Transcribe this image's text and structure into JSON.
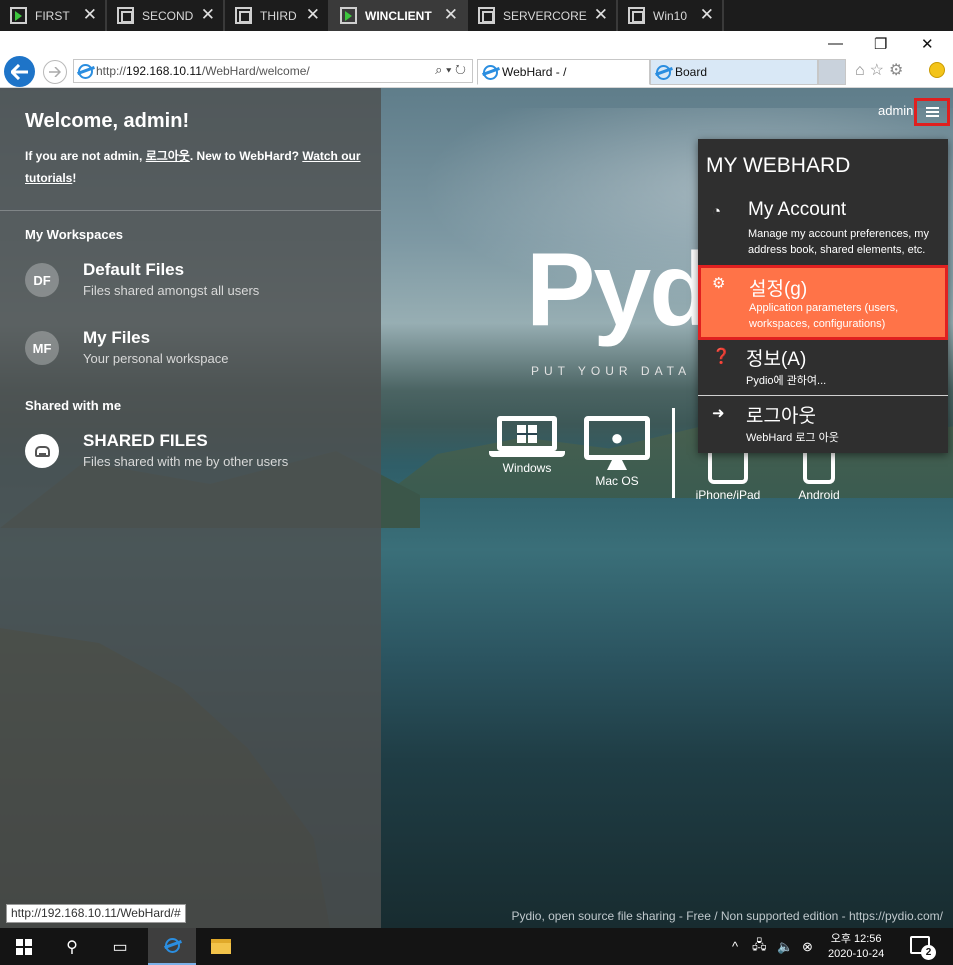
{
  "vm_tabs": [
    {
      "label": "FIRST",
      "active": false,
      "icon": "vm-play-icon"
    },
    {
      "label": "SECOND",
      "active": false,
      "icon": "vm-window-icon"
    },
    {
      "label": "THIRD",
      "active": false,
      "icon": "vm-window-icon"
    },
    {
      "label": "WINCLIENT",
      "active": true,
      "icon": "vm-play-icon"
    },
    {
      "label": "SERVERCORE",
      "active": false,
      "icon": "vm-window-icon"
    },
    {
      "label": "Win10",
      "active": false,
      "icon": "vm-window-icon"
    }
  ],
  "browser": {
    "url_prefix": "http://",
    "url_host": "192.168.10.11",
    "url_path": "/WebHard/welcome/",
    "tabs": [
      {
        "label": "WebHard - /",
        "active": true
      },
      {
        "label": "Board",
        "active": false
      }
    ]
  },
  "left_panel": {
    "welcome": "Welcome, admin!",
    "sub_prefix": "If you are not admin, ",
    "logout_link": "로그아웃",
    "sub_middle": ". New to WebHard? ",
    "tutorial_link": "Watch our tutorials",
    "sub_suffix": "!",
    "workspaces_heading": "My Workspaces",
    "workspaces": [
      {
        "initials": "DF",
        "title": "Default Files",
        "desc": "Files shared amongst all users"
      },
      {
        "initials": "MF",
        "title": "My Files",
        "desc": "Your personal workspace"
      }
    ],
    "shared_heading": "Shared with me",
    "shared": {
      "title": "SHARED FILES",
      "desc": "Files shared with me by other users",
      "icon": "drive-icon"
    }
  },
  "center": {
    "logo": "Pydio",
    "tagline": "PUT YOUR DATA",
    "apps": [
      {
        "label": "Windows",
        "icon": "windows-laptop-icon"
      },
      {
        "label": "Mac OS",
        "icon": "apple-monitor-icon"
      },
      {
        "label": "iPhone/iPad",
        "icon": "phone-icon"
      },
      {
        "label": "Android",
        "icon": "android-phone-icon"
      }
    ]
  },
  "user_menu": {
    "username": "admin",
    "title": "MY WEBHARD",
    "items": [
      {
        "label": "My Account",
        "desc": "Manage my account preferences, my address book, shared elements, etc.",
        "icon": "dashboard-icon",
        "highlighted": false
      },
      {
        "label": "설정(g)",
        "desc": "Application parameters (users, workspaces, configurations)",
        "icon": "gears-icon",
        "highlighted": true
      },
      {
        "label": "정보(A)",
        "desc": "Pydio에 관하여...",
        "icon": "question-circle-icon",
        "highlighted": false
      },
      {
        "label": "로그아웃",
        "desc": "WebHard 로그 아웃",
        "icon": "sign-out-icon",
        "highlighted": false
      }
    ]
  },
  "footer": "Pydio, open source file sharing - Free / Non supported edition - https://pydio.com/",
  "status_url": "http://192.168.10.11/WebHard/#",
  "taskbar": {
    "clock_time": "오후 12:56",
    "clock_date": "2020-10-24",
    "notification_count": "2"
  },
  "colors": {
    "accent_highlight": "#ff7348",
    "highlight_border": "#e02020",
    "browser_back": "#1e74c8"
  }
}
